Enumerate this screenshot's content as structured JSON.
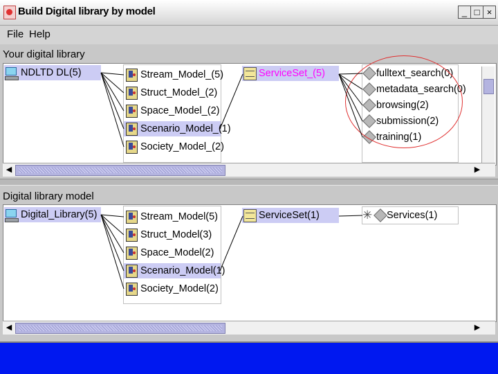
{
  "window": {
    "title": "Build Digital library by model",
    "controls": [
      "_",
      "□",
      "×"
    ]
  },
  "menu": [
    "File",
    "Help"
  ],
  "top_section": {
    "label": "Your digital library",
    "root": "NDLTD DL(5)",
    "models": [
      "Stream_Model_(5)",
      "Struct_Model_(2)",
      "Space_Model_(2)",
      "Scenario_Model_(1)",
      "Society_Model_(2)"
    ],
    "selected_model": "Scenario_Model_(1)",
    "serviceset": "ServiceSet_(5)",
    "serviceset_color": "#ff00ff",
    "services": [
      "fulltext_search(0)",
      "metadata_search(0)",
      "browsing(2)",
      "submission(2)",
      "training(1)"
    ],
    "highlight_color": "#e03030"
  },
  "bottom_section": {
    "label": "Digital library model",
    "root": "Digital_Library(5)",
    "models": [
      "Stream_Model(5)",
      "Struct_Model(3)",
      "Space_Model(2)",
      "Scenario_Model(1)",
      "Society_Model(2)"
    ],
    "selected_model": "Scenario_Model(1)",
    "serviceset": "ServiceSet(1)",
    "services": [
      "Services(1)"
    ]
  },
  "colors": {
    "selection": "#ccccf4",
    "window_bg": "#c8c8c8",
    "desktop": "#0018f0"
  },
  "icons": {
    "root": "computer-icon",
    "model": "model-icon",
    "serviceset": "document-icon",
    "service": "diamond-icon",
    "services_group": "star-icon"
  }
}
